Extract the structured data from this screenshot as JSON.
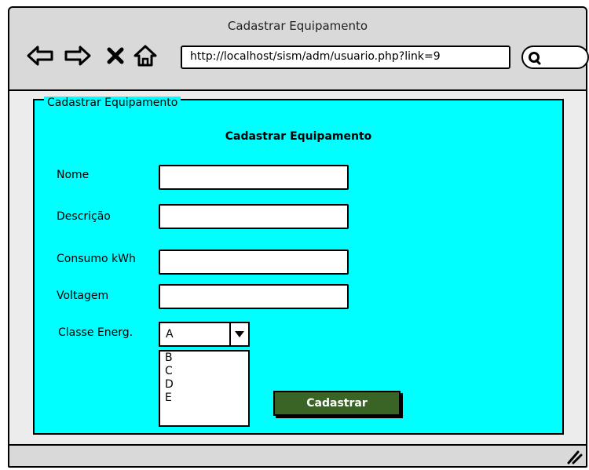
{
  "window": {
    "title": "Cadastrar Equipamento"
  },
  "toolbar": {
    "address": "http://localhost/sism/adm/usuario.php?link=9",
    "icons": [
      "back-arrow-icon",
      "forward-arrow-icon",
      "close-x-icon",
      "home-icon",
      "search-icon"
    ]
  },
  "form": {
    "legend": "Cadastrar Equipamento",
    "heading": "Cadastrar Equipamento",
    "fields": {
      "nome": {
        "label": "Nome",
        "value": ""
      },
      "descricao": {
        "label": "Descrição",
        "value": ""
      },
      "consumo": {
        "label": "Consumo kWh",
        "value": ""
      },
      "voltagem": {
        "label": "Voltagem",
        "value": ""
      }
    },
    "classe": {
      "label": "Classe Energ.",
      "selected": "A",
      "options": [
        "B",
        "C",
        "D",
        "E"
      ]
    },
    "submit_label": "Cadastrar"
  },
  "colors": {
    "form_background": "#00ffff",
    "button_background": "#3a6426",
    "chrome": "#d9d9d9"
  }
}
